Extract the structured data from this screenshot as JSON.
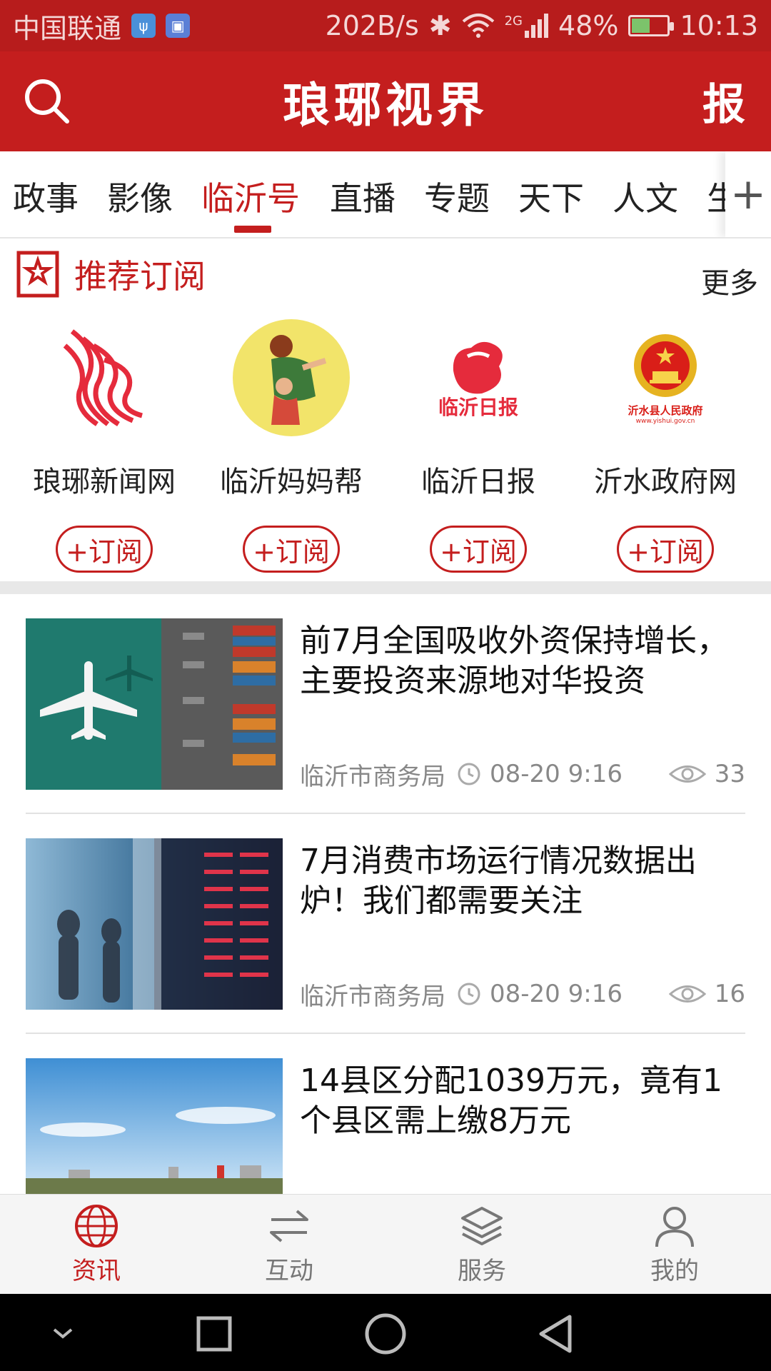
{
  "status_bar": {
    "carrier": "中国联通",
    "speed": "202B/s",
    "network": "2G",
    "battery": "48%",
    "battery_level": 0.48,
    "time": "10:13"
  },
  "header": {
    "title": "琅琊视界",
    "report_label": "报",
    "brand_color": "#c41e1e"
  },
  "tabs": [
    {
      "label": "政事",
      "active": false
    },
    {
      "label": "影像",
      "active": false
    },
    {
      "label": "临沂号",
      "active": true
    },
    {
      "label": "直播",
      "active": false
    },
    {
      "label": "专题",
      "active": false
    },
    {
      "label": "天下",
      "active": false
    },
    {
      "label": "人文",
      "active": false
    },
    {
      "label": "生",
      "active": false
    }
  ],
  "recommend": {
    "title": "推荐订阅",
    "more": "更多",
    "subscribe_label": "+订阅",
    "items": [
      {
        "name": "琅琊新闻网",
        "logo": "flame-logo"
      },
      {
        "name": "临沂妈妈帮",
        "logo": "mother-child-logo"
      },
      {
        "name": "临沂日报",
        "logo": "newspaper-logo",
        "logo_text": "临沂日报"
      },
      {
        "name": "沂水政府网",
        "logo": "national-emblem-logo",
        "logo_text": "沂水县人民政府",
        "logo_url_text": "www.yishui.gov.cn"
      }
    ]
  },
  "news": [
    {
      "title": "前7月全国吸收外资保持增长，主要投资来源地对华投资",
      "source": "临沂市商务局",
      "time": "08-20 9:16",
      "views": "33"
    },
    {
      "title": "7月消费市场运行情况数据出炉！我们都需要关注",
      "source": "临沂市商务局",
      "time": "08-20 9:16",
      "views": "16"
    },
    {
      "title": "14县区分配1039万元，竟有1个县区需上缴8万元",
      "source": "",
      "time": "",
      "views": ""
    }
  ],
  "bottom_nav": [
    {
      "label": "资讯",
      "icon": "globe-icon",
      "active": true
    },
    {
      "label": "互动",
      "icon": "swap-icon",
      "active": false
    },
    {
      "label": "服务",
      "icon": "layers-icon",
      "active": false
    },
    {
      "label": "我的",
      "icon": "user-icon",
      "active": false
    }
  ]
}
